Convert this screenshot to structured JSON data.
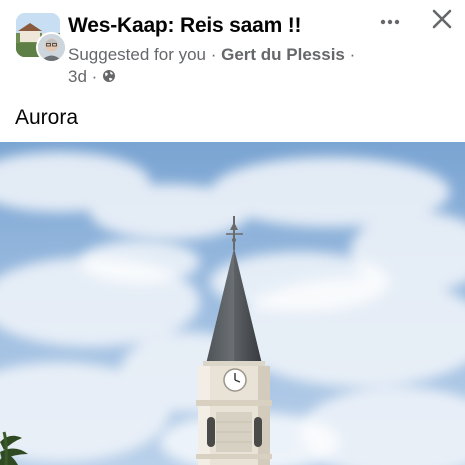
{
  "post": {
    "group_name": "Wes-Kaap: Reis saam !!",
    "suggested_label": "Suggested for you",
    "separator": " · ",
    "author": "Gert du Plessis",
    "time": "3d",
    "text": "Aurora",
    "privacy_icon": "globe-icon",
    "more_icon": "more-horizontal-icon",
    "close_icon": "close-icon",
    "photo_subject": "church-steeple-photo"
  }
}
